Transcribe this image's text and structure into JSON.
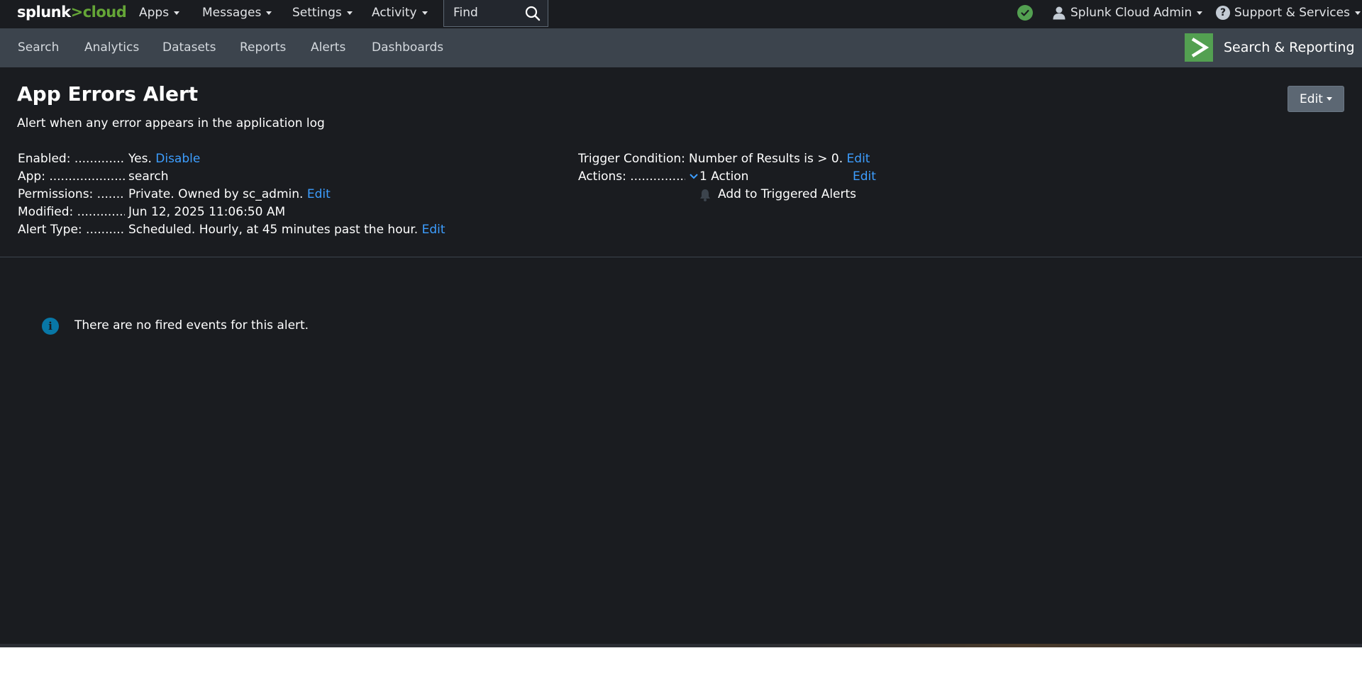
{
  "topbar": {
    "logo_part1": "splunk",
    "logo_part2": ">cloud",
    "nav": [
      "Apps",
      "Messages",
      "Settings",
      "Activity"
    ],
    "find_label": "Find",
    "user_label": "Splunk Cloud Admin",
    "support_label": "Support & Services",
    "status_color": "#53a051"
  },
  "appbar": {
    "nav": [
      "Search",
      "Analytics",
      "Datasets",
      "Reports",
      "Alerts",
      "Dashboards"
    ],
    "app_title": "Search & Reporting",
    "app_logo_color": "#53a051"
  },
  "alert": {
    "title": "App Errors Alert",
    "description": "Alert when any error appears in the application log",
    "edit_button": "Edit",
    "details": {
      "enabled_label": "Enabled: ......................................................",
      "enabled_value": "Yes.",
      "enabled_link": "Disable",
      "app_label": "App: ..............................................................",
      "app_value": "search",
      "permissions_label": "Permissions: ...............................................",
      "permissions_value": "Private. Owned by sc_admin.",
      "permissions_link": "Edit",
      "modified_label": "Modified: ......................................................",
      "modified_value": "Jun 12, 2025 11:06:50 AM",
      "alert_type_label": "Alert Type: ....................................................",
      "alert_type_value": "Scheduled. Hourly, at 45 minutes past the hour.",
      "alert_type_link": "Edit",
      "trigger_label": "Trigger Condition: ......................................",
      "trigger_value": "Number of Results is > 0.",
      "trigger_link": "Edit",
      "actions_label": "Actions: ........................................................",
      "actions_value": "1 Action",
      "actions_link": "Edit",
      "action_item": "Add to Triggered Alerts"
    },
    "empty_message": "There are no fired events for this alert."
  },
  "colors": {
    "background": "#1a1c20",
    "appbar": "#3c444d",
    "link": "#3d9eff",
    "info": "#0877a6"
  }
}
